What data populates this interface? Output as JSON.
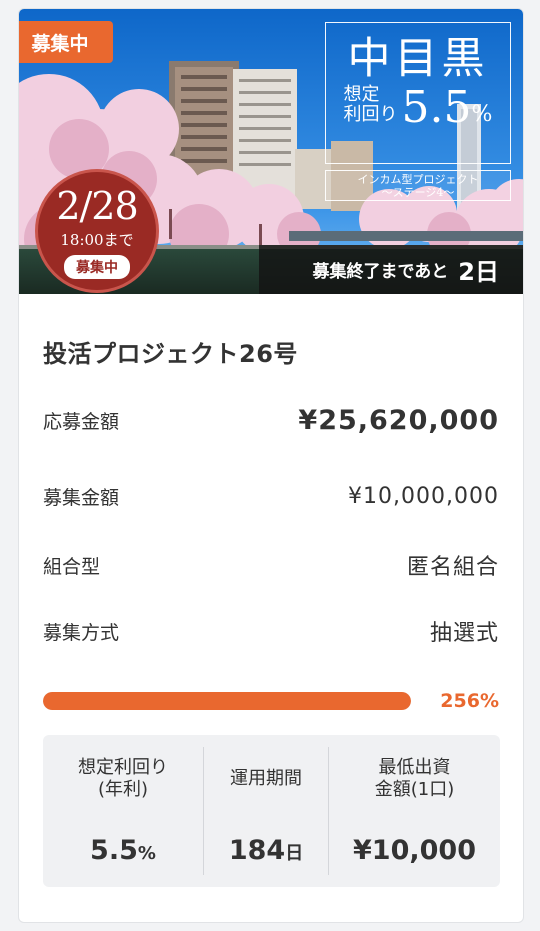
{
  "hero": {
    "tag": "募集中",
    "date": "2/28",
    "time": "18:00まで",
    "status": "募集中",
    "area": "中目黒",
    "yield_label_1": "想定",
    "yield_label_2": "利回り",
    "yield_value": "5.5",
    "yield_unit": "%",
    "subtitle_1": "インカム型プロジェクト",
    "subtitle_2": "〜ステージ4〜",
    "deadline_text": "募集終了まであと",
    "deadline_days": "2日"
  },
  "project": {
    "name": "投活プロジェクト26号",
    "rows": [
      {
        "label": "応募金額",
        "value": "¥25,620,000"
      },
      {
        "label": "募集金額",
        "value": "¥10,000,000"
      },
      {
        "label": "組合型",
        "value": "匿名組合"
      },
      {
        "label": "募集方式",
        "value": "抽選式"
      }
    ],
    "progress_percent": 256,
    "progress_text": "256%"
  },
  "stats": [
    {
      "label_1": "想定利回り",
      "label_2": "(年利)",
      "value": "5.5",
      "unit": "%"
    },
    {
      "label_1": "運用期間",
      "label_2": "",
      "value": "184",
      "unit": "日"
    },
    {
      "label_1": "最低出資",
      "label_2": "金額(1口)",
      "value": "¥10,000",
      "unit": ""
    }
  ],
  "colors": {
    "accent": "#e9682f",
    "badge": "#9a2a24",
    "text": "#333333",
    "panel": "#f0f1f3"
  }
}
